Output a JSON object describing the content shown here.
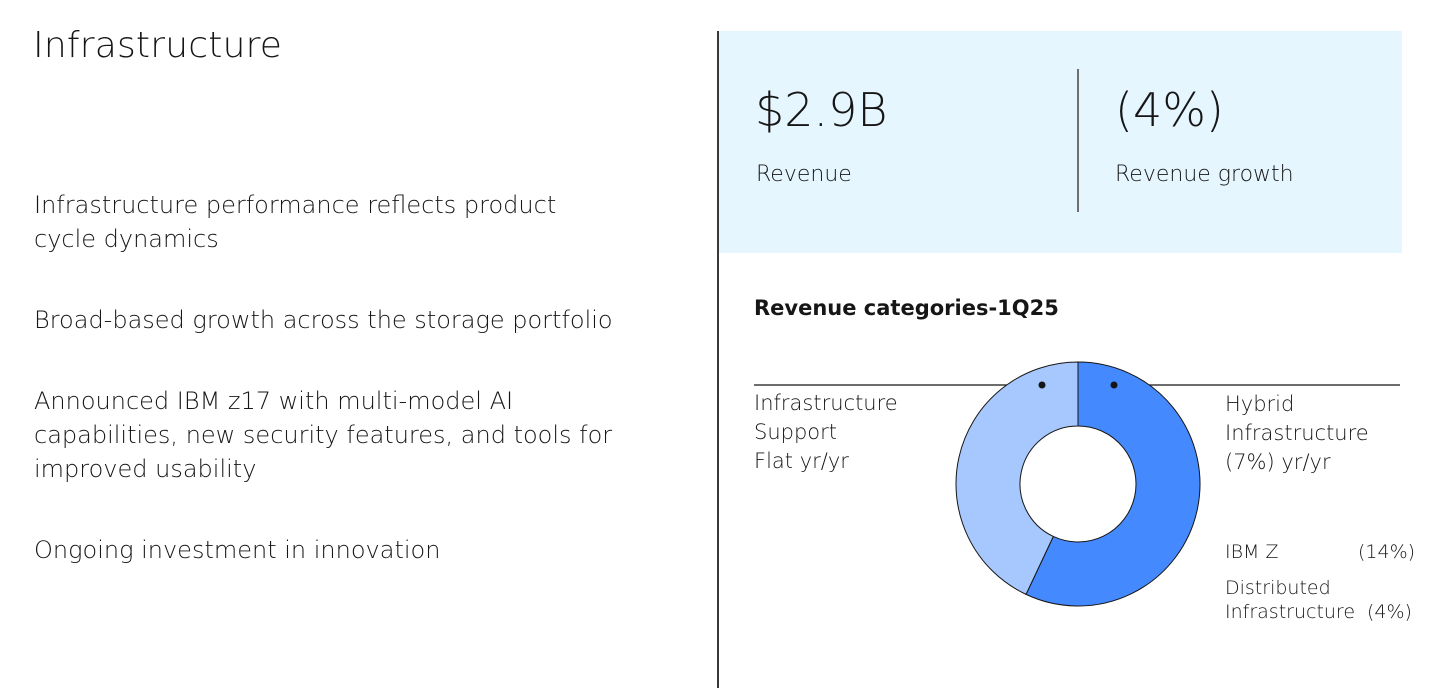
{
  "page": {
    "title": "Infrastructure",
    "bullets": [
      "Infrastructure performance reflects product\ncycle dynamics",
      "Broad-based growth across the storage portfolio",
      "Announced IBM z17 with multi-model AI\ncapabilities, new security features, and tools for\nimproved usability",
      "Ongoing investment in innovation"
    ]
  },
  "kpis": [
    {
      "value": "$2.9B",
      "label": "Revenue"
    },
    {
      "value": "(4%)",
      "label": "Revenue growth"
    }
  ],
  "colors": {
    "panel_bg": "#e5f6ff",
    "hybrid": "#4589ff",
    "support": "#a6c8ff",
    "divider": "#393939"
  },
  "chart_data": {
    "type": "pie",
    "donut": true,
    "title": "Revenue categories-1Q25",
    "slices": [
      {
        "name": "Hybrid Infrastructure",
        "share": 0.57,
        "color": "#4589ff"
      },
      {
        "name": "Infrastructure Support",
        "share": 0.43,
        "color": "#a6c8ff"
      }
    ],
    "labels": {
      "support": [
        "Infrastructure",
        "Support",
        "Flat yr/yr"
      ],
      "hybrid": [
        "Hybrid",
        "Infrastructure",
        "(7%) yr/yr"
      ]
    },
    "breakdown": [
      {
        "name": "IBM Z",
        "growth": "(14%)"
      },
      {
        "name_lines": [
          "Distributed",
          "Infrastructure"
        ],
        "growth": "(4%)"
      }
    ]
  }
}
